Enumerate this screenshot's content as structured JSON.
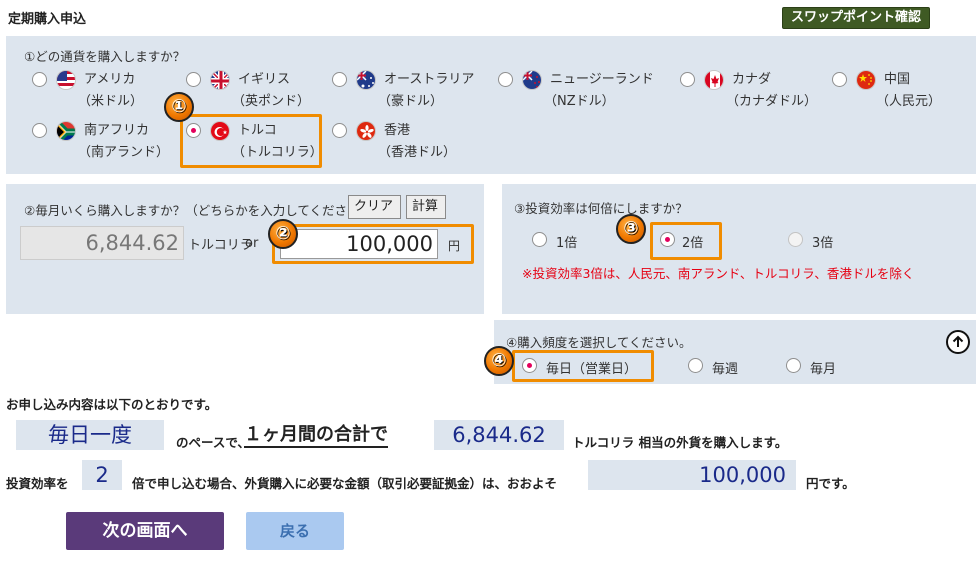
{
  "header": {
    "title": "定期購入申込",
    "swap_button": "スワップポイント確認"
  },
  "q1": {
    "label": "①どの通貨を購入しますか？",
    "currencies": [
      {
        "name": "アメリカ",
        "sub": "（米ドル）",
        "flag": "us-flag-icon"
      },
      {
        "name": "イギリス",
        "sub": "（英ポンド）",
        "flag": "uk-flag-icon"
      },
      {
        "name": "オーストラリア",
        "sub": "（豪ドル）",
        "flag": "au-flag-icon"
      },
      {
        "name": "ニュージーランド",
        "sub": "（NZドル）",
        "flag": "nz-flag-icon"
      },
      {
        "name": "カナダ",
        "sub": "（カナダドル）",
        "flag": "ca-flag-icon"
      },
      {
        "name": "中国",
        "sub": "（人民元）",
        "flag": "cn-flag-icon"
      },
      {
        "name": "南アフリカ",
        "sub": "（南アランド）",
        "flag": "za-flag-icon"
      },
      {
        "name": "トルコ",
        "sub": "（トルコリラ）",
        "flag": "tr-flag-icon"
      },
      {
        "name": "香港",
        "sub": "（香港ドル）",
        "flag": "hk-flag-icon"
      }
    ],
    "selected_index": 7
  },
  "q2": {
    "label": "②毎月いくら購入しますか？（どちらかを入力してください）",
    "clear_button": "クリア",
    "calc_button": "計算",
    "foreign_amount": "6,844.62",
    "foreign_unit": "トルコリラ",
    "or_text": "or",
    "yen_amount": "100,000",
    "yen_unit": "円"
  },
  "q3": {
    "label": "③投資効率は何倍にしますか？",
    "options": [
      "1倍",
      "2倍",
      "3倍"
    ],
    "selected_index": 1,
    "note": "※投資効率3倍は、人民元、南アランド、トルコリラ、香港ドルを除く",
    "note_color": "#e60012"
  },
  "q4": {
    "label": "④購入頻度を選択してください。",
    "options": [
      "毎日（営業日）",
      "毎週",
      "毎月"
    ],
    "selected_index": 0
  },
  "badges": [
    "①",
    "②",
    "③",
    "④"
  ],
  "summary": {
    "intro": "お申し込み内容は以下のとおりです。",
    "frequency": "毎日一度",
    "pace_text": "のペースで、",
    "period_text": "１ヶ月間の合計で",
    "amount": "6,844.62",
    "amount_suffix": "トルコリラ 相当の外貨を購入します。",
    "leverage_prefix": "投資効率を",
    "leverage": "2",
    "leverage_text": "倍で申し込む場合、外貨購入に必要な金額（取引必要証拠金）は、おおよそ",
    "margin": "100,000",
    "margin_suffix": "円です。"
  },
  "buttons": {
    "next": "次の画面へ",
    "back": "戻る"
  },
  "colors": {
    "panel": "#dde5ee",
    "highlight": "#f08c00",
    "swap_button": "#3f5a24",
    "next_button": "#5a3a7a",
    "back_button": "#aac9f0"
  }
}
